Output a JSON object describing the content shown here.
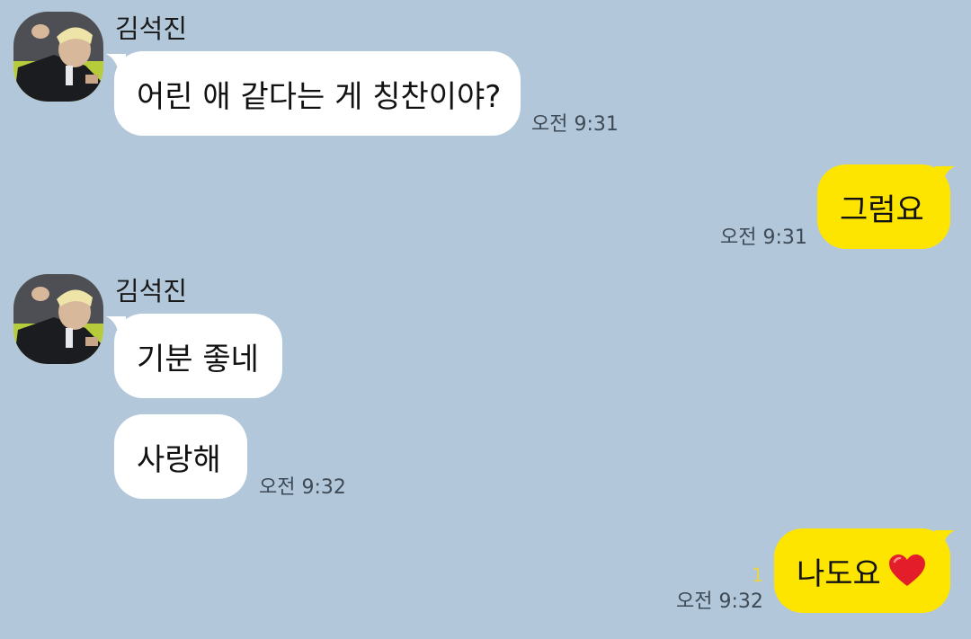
{
  "colors": {
    "background": "#b2c7da",
    "bubble_in": "#ffffff",
    "bubble_out": "#fee500",
    "unread": "#e7d44a"
  },
  "messages": [
    {
      "sender": "김석진",
      "text": "어린 애 같다는 게 칭찬이야?",
      "time": "오전 9:31",
      "direction": "in"
    },
    {
      "text": "그럼요",
      "time": "오전 9:31",
      "direction": "out"
    },
    {
      "sender": "김석진",
      "text": "기분 좋네",
      "direction": "in"
    },
    {
      "text": "사랑해",
      "time": "오전 9:32",
      "direction": "in"
    },
    {
      "text": "나도요",
      "emoji": "heart-icon",
      "unread": "1",
      "time": "오전 9:32",
      "direction": "out"
    }
  ]
}
